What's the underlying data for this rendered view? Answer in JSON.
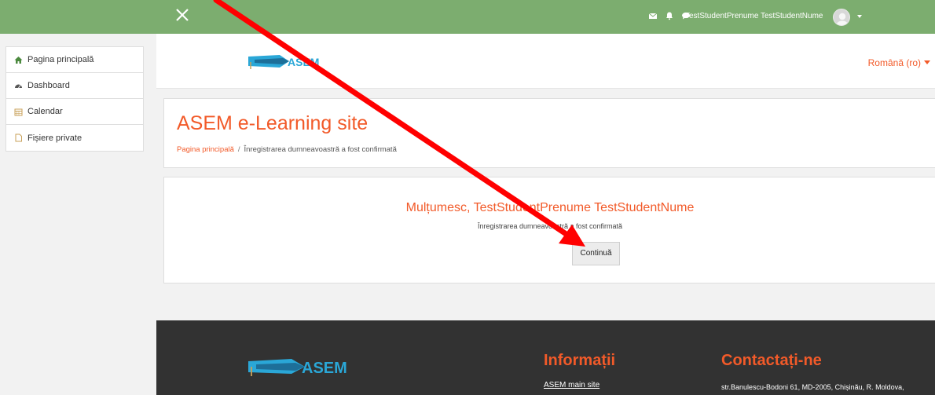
{
  "topbar": {
    "user_name": "TestStudentPrenume TestStudentNume"
  },
  "icons": {
    "close": "close-icon",
    "messages": "envelope-icon",
    "notifications": "bell-icon",
    "chat": "comment-icon",
    "user_menu": "chevron-down-icon"
  },
  "sidebar": {
    "items": [
      {
        "label": "Pagina principală",
        "icon": "home-icon"
      },
      {
        "label": "Dashboard",
        "icon": "dashboard-icon"
      },
      {
        "label": "Calendar",
        "icon": "calendar-icon"
      },
      {
        "label": "Fișiere private",
        "icon": "file-icon"
      }
    ]
  },
  "header": {
    "logo_text": "ASEM",
    "language": "Română (ro)"
  },
  "page": {
    "title": "ASEM e-Learning site",
    "breadcrumb": {
      "home": "Pagina principală",
      "separator": "/",
      "current": "Înregistrarea dumneavoastră a fost confirmată"
    }
  },
  "content": {
    "thanks": "Mulțumesc, TestStudentPrenume TestStudentNume",
    "confirmation": "Înregistrarea dumneavoastră a fost confirmată",
    "continue_label": "Continuă"
  },
  "footer": {
    "logo_text": "ASEM",
    "info_title": "Informații",
    "info_link": "ASEM main site",
    "contact_title": "Contactați-ne",
    "contact_text": "str.Banulescu-Bodoni 61, MD-2005, Chișinău, R. Moldova,"
  },
  "colors": {
    "topbar": "#7cad6f",
    "accent": "#f25a29",
    "footer": "#323232",
    "annotation_arrow": "#ff0000"
  }
}
